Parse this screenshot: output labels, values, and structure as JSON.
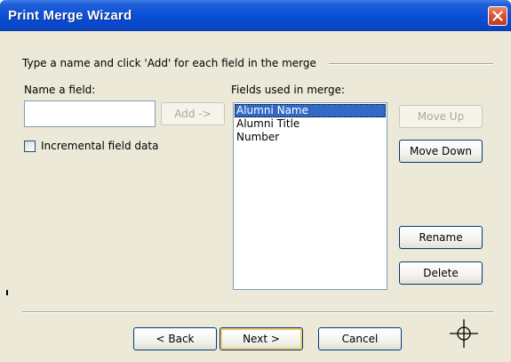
{
  "window": {
    "title": "Print Merge Wizard",
    "close_icon": "close-icon"
  },
  "instructions": "Type a name and click 'Add' for each field in the merge",
  "name_field": {
    "label": "Name a field:",
    "value": "",
    "add_label": "Add ->"
  },
  "incremental": {
    "label": "Incremental field data",
    "checked": false
  },
  "fields": {
    "label": "Fields used in merge:",
    "items": [
      "Alumni Name",
      "Alumni Title",
      "Number"
    ],
    "selected": "Alumni Name"
  },
  "side_buttons": {
    "move_up": "Move Up",
    "move_down": "Move Down",
    "rename": "Rename",
    "delete": "Delete"
  },
  "nav": {
    "back": "< Back",
    "next": "Next >",
    "cancel": "Cancel"
  },
  "icons": {
    "crosshair": "crosshair-icon"
  },
  "colors": {
    "titlebar": "#0a4fd6",
    "dialog_bg": "#ece9d8",
    "selection": "#316ac5",
    "close_button": "#d6563a"
  }
}
